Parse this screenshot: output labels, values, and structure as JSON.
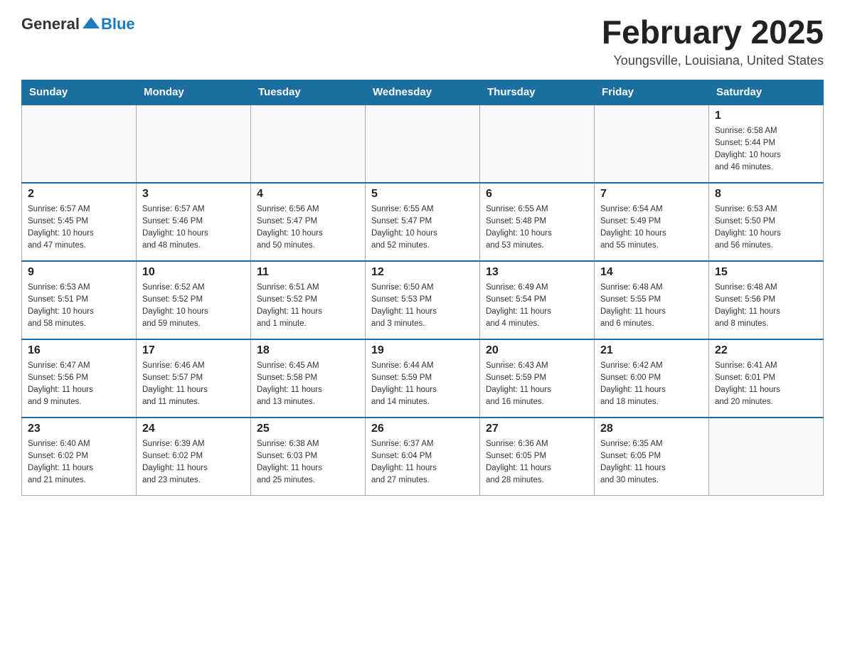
{
  "header": {
    "logo": {
      "general": "General",
      "blue": "Blue"
    },
    "title": "February 2025",
    "subtitle": "Youngsville, Louisiana, United States"
  },
  "weekdays": [
    "Sunday",
    "Monday",
    "Tuesday",
    "Wednesday",
    "Thursday",
    "Friday",
    "Saturday"
  ],
  "weeks": [
    [
      {
        "day": "",
        "info": ""
      },
      {
        "day": "",
        "info": ""
      },
      {
        "day": "",
        "info": ""
      },
      {
        "day": "",
        "info": ""
      },
      {
        "day": "",
        "info": ""
      },
      {
        "day": "",
        "info": ""
      },
      {
        "day": "1",
        "info": "Sunrise: 6:58 AM\nSunset: 5:44 PM\nDaylight: 10 hours\nand 46 minutes."
      }
    ],
    [
      {
        "day": "2",
        "info": "Sunrise: 6:57 AM\nSunset: 5:45 PM\nDaylight: 10 hours\nand 47 minutes."
      },
      {
        "day": "3",
        "info": "Sunrise: 6:57 AM\nSunset: 5:46 PM\nDaylight: 10 hours\nand 48 minutes."
      },
      {
        "day": "4",
        "info": "Sunrise: 6:56 AM\nSunset: 5:47 PM\nDaylight: 10 hours\nand 50 minutes."
      },
      {
        "day": "5",
        "info": "Sunrise: 6:55 AM\nSunset: 5:47 PM\nDaylight: 10 hours\nand 52 minutes."
      },
      {
        "day": "6",
        "info": "Sunrise: 6:55 AM\nSunset: 5:48 PM\nDaylight: 10 hours\nand 53 minutes."
      },
      {
        "day": "7",
        "info": "Sunrise: 6:54 AM\nSunset: 5:49 PM\nDaylight: 10 hours\nand 55 minutes."
      },
      {
        "day": "8",
        "info": "Sunrise: 6:53 AM\nSunset: 5:50 PM\nDaylight: 10 hours\nand 56 minutes."
      }
    ],
    [
      {
        "day": "9",
        "info": "Sunrise: 6:53 AM\nSunset: 5:51 PM\nDaylight: 10 hours\nand 58 minutes."
      },
      {
        "day": "10",
        "info": "Sunrise: 6:52 AM\nSunset: 5:52 PM\nDaylight: 10 hours\nand 59 minutes."
      },
      {
        "day": "11",
        "info": "Sunrise: 6:51 AM\nSunset: 5:52 PM\nDaylight: 11 hours\nand 1 minute."
      },
      {
        "day": "12",
        "info": "Sunrise: 6:50 AM\nSunset: 5:53 PM\nDaylight: 11 hours\nand 3 minutes."
      },
      {
        "day": "13",
        "info": "Sunrise: 6:49 AM\nSunset: 5:54 PM\nDaylight: 11 hours\nand 4 minutes."
      },
      {
        "day": "14",
        "info": "Sunrise: 6:48 AM\nSunset: 5:55 PM\nDaylight: 11 hours\nand 6 minutes."
      },
      {
        "day": "15",
        "info": "Sunrise: 6:48 AM\nSunset: 5:56 PM\nDaylight: 11 hours\nand 8 minutes."
      }
    ],
    [
      {
        "day": "16",
        "info": "Sunrise: 6:47 AM\nSunset: 5:56 PM\nDaylight: 11 hours\nand 9 minutes."
      },
      {
        "day": "17",
        "info": "Sunrise: 6:46 AM\nSunset: 5:57 PM\nDaylight: 11 hours\nand 11 minutes."
      },
      {
        "day": "18",
        "info": "Sunrise: 6:45 AM\nSunset: 5:58 PM\nDaylight: 11 hours\nand 13 minutes."
      },
      {
        "day": "19",
        "info": "Sunrise: 6:44 AM\nSunset: 5:59 PM\nDaylight: 11 hours\nand 14 minutes."
      },
      {
        "day": "20",
        "info": "Sunrise: 6:43 AM\nSunset: 5:59 PM\nDaylight: 11 hours\nand 16 minutes."
      },
      {
        "day": "21",
        "info": "Sunrise: 6:42 AM\nSunset: 6:00 PM\nDaylight: 11 hours\nand 18 minutes."
      },
      {
        "day": "22",
        "info": "Sunrise: 6:41 AM\nSunset: 6:01 PM\nDaylight: 11 hours\nand 20 minutes."
      }
    ],
    [
      {
        "day": "23",
        "info": "Sunrise: 6:40 AM\nSunset: 6:02 PM\nDaylight: 11 hours\nand 21 minutes."
      },
      {
        "day": "24",
        "info": "Sunrise: 6:39 AM\nSunset: 6:02 PM\nDaylight: 11 hours\nand 23 minutes."
      },
      {
        "day": "25",
        "info": "Sunrise: 6:38 AM\nSunset: 6:03 PM\nDaylight: 11 hours\nand 25 minutes."
      },
      {
        "day": "26",
        "info": "Sunrise: 6:37 AM\nSunset: 6:04 PM\nDaylight: 11 hours\nand 27 minutes."
      },
      {
        "day": "27",
        "info": "Sunrise: 6:36 AM\nSunset: 6:05 PM\nDaylight: 11 hours\nand 28 minutes."
      },
      {
        "day": "28",
        "info": "Sunrise: 6:35 AM\nSunset: 6:05 PM\nDaylight: 11 hours\nand 30 minutes."
      },
      {
        "day": "",
        "info": ""
      }
    ]
  ]
}
